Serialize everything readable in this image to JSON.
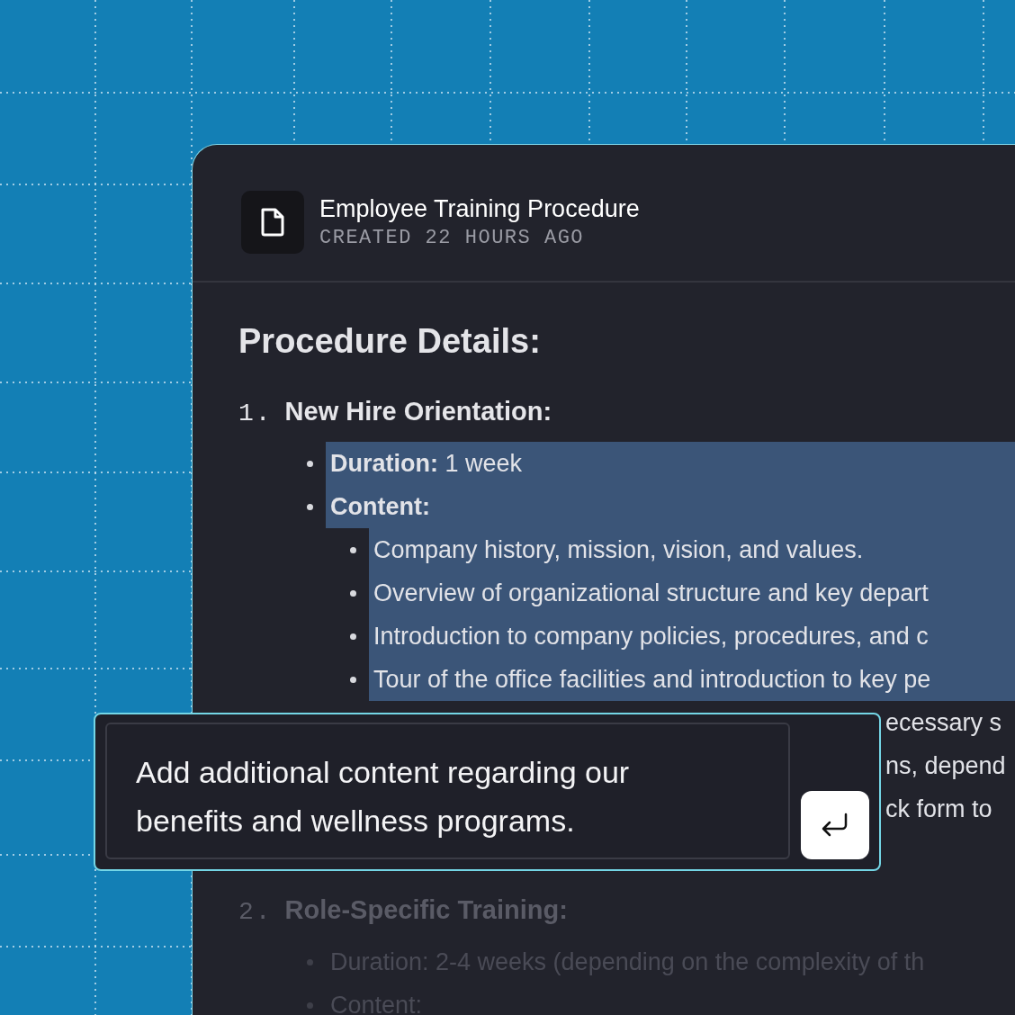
{
  "document": {
    "title": "Employee Training Procedure",
    "subtitle": "CREATED 22 HOURS AGO"
  },
  "content": {
    "heading": "Procedure Details:",
    "sections": [
      {
        "number": "1.",
        "title": "New Hire Orientation:",
        "dimmed": false,
        "items": [
          {
            "kind": "bullet",
            "label": "Duration:",
            "text": "1 week",
            "highlighted": true
          },
          {
            "kind": "bullet",
            "label": "Content:",
            "highlighted": true,
            "children": [
              {
                "kind": "bullet",
                "text": "Company history, mission, vision, and values.",
                "highlighted": true
              },
              {
                "kind": "bullet",
                "text": "Overview of organizational structure and key depart",
                "highlighted": true
              },
              {
                "kind": "bullet",
                "text": "Introduction to company policies, procedures, and c",
                "highlighted": true
              },
              {
                "kind": "bullet",
                "text": "Tour of the office facilities and introduction to key pe",
                "highlighted": true
              },
              {
                "kind": "obscured",
                "text": "ecessary s",
                "highlighted": false
              },
              {
                "kind": "obscured",
                "text": "ns, depend",
                "highlighted": false
              },
              {
                "kind": "obscured",
                "text": "ck form to",
                "highlighted": false
              }
            ]
          }
        ]
      },
      {
        "number": "2.",
        "title": "Role-Specific Training:",
        "dimmed": true,
        "items": [
          {
            "kind": "bullet",
            "text": "Duration: 2-4 weeks (depending on the complexity of th",
            "highlighted": false
          },
          {
            "kind": "bullet",
            "text": "Content:",
            "highlighted": false
          }
        ]
      }
    ]
  },
  "prompt": {
    "value": "Add additional content regarding our benefits and wellness programs."
  }
}
